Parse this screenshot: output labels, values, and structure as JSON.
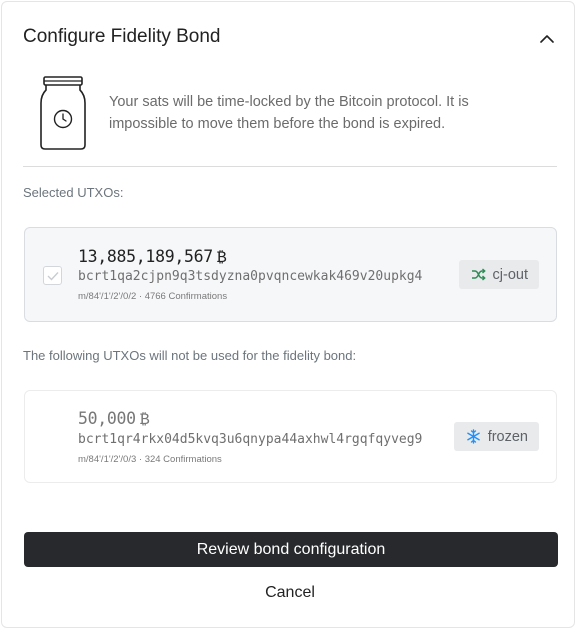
{
  "header": {
    "title": "Configure Fidelity Bond",
    "collapse_icon": "chevron-up-icon"
  },
  "info": {
    "icon": "jar-clock-icon",
    "text": "Your sats will be time-locked by the Bitcoin protocol. It is impossible to move them before the bond is expired."
  },
  "selected_section": {
    "label": "Selected UTXOs:",
    "utxos": [
      {
        "amount": "13,885,189,567",
        "unit_symbol": "₿",
        "address": "bcrt1qa2cjpn9q3tsdyzna0pvqncewkak469v20upkg4",
        "meta": "m/84'/1'/2'/0/2 · 4766 Confirmations",
        "tag": "cj-out",
        "tag_icon": "shuffle-icon",
        "tag_color": "#2e8b57",
        "checked": true
      }
    ]
  },
  "unused_section": {
    "label": "The following UTXOs will not be used for the fidelity bond:",
    "utxos": [
      {
        "amount": "50,000",
        "unit_symbol": "₿",
        "address": "bcrt1qr4rkx04d5kvq3u6qnypa44axhwl4rgqfqyveg9",
        "meta": "m/84'/1'/2'/0/3 · 324 Confirmations",
        "tag": "frozen",
        "tag_icon": "snowflake-icon",
        "tag_color": "#1e90ff"
      }
    ]
  },
  "actions": {
    "review_label": "Review bond configuration",
    "cancel_label": "Cancel"
  }
}
